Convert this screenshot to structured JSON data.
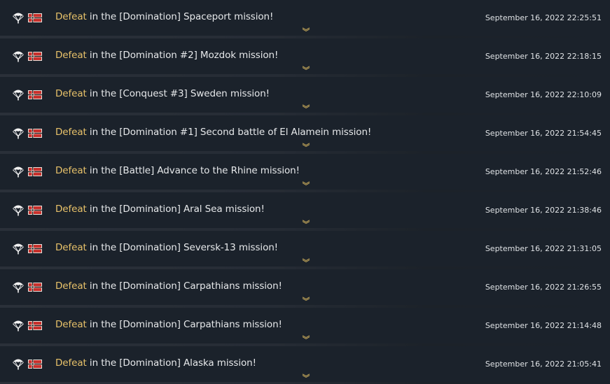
{
  "log": {
    "entries": [
      {
        "result": "Defeat",
        "text": " in the [Domination] Spaceport mission!",
        "time": "September 16, 2022 22:25:51"
      },
      {
        "result": "Defeat",
        "text": " in the [Domination #2] Mozdok mission!",
        "time": "September 16, 2022 22:18:15"
      },
      {
        "result": "Defeat",
        "text": " in the [Conquest #3] Sweden mission!",
        "time": "September 16, 2022 22:10:09"
      },
      {
        "result": "Defeat",
        "text": " in the [Domination #1] Second battle of El Alamein mission!",
        "time": "September 16, 2022 21:54:45"
      },
      {
        "result": "Defeat",
        "text": " in the [Battle] Advance to the Rhine mission!",
        "time": "September 16, 2022 21:52:46"
      },
      {
        "result": "Defeat",
        "text": " in the [Domination] Aral Sea mission!",
        "time": "September 16, 2022 21:38:46"
      },
      {
        "result": "Defeat",
        "text": " in the [Domination] Seversk-13 mission!",
        "time": "September 16, 2022 21:31:05"
      },
      {
        "result": "Defeat",
        "text": " in the [Domination] Carpathians mission!",
        "time": "September 16, 2022 21:26:55"
      },
      {
        "result": "Defeat",
        "text": " in the [Domination] Carpathians mission!",
        "time": "September 16, 2022 21:14:48"
      },
      {
        "result": "Defeat",
        "text": " in the [Domination] Alaska mission!",
        "time": "September 16, 2022 21:05:41"
      }
    ]
  },
  "icons": {
    "mode": "paratrooper-icon",
    "nation": "germany-flag-icon",
    "expand": "chevron-down-icon"
  },
  "colors": {
    "background": "#1b222b",
    "result": "#e8c26a",
    "text": "#e6e8ea",
    "flag_red": "#c8302c"
  }
}
